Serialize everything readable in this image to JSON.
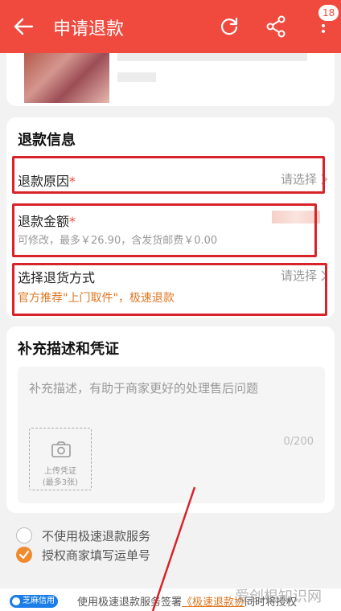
{
  "header": {
    "title": "申请退款",
    "badge_count": "18",
    "bg_color": "#f04a3f",
    "icons": [
      "back-arrow-icon",
      "refresh-icon",
      "share-icon",
      "more-vertical-icon"
    ]
  },
  "refund_info": {
    "section_title": "退款信息",
    "reason": {
      "label": "退款原因",
      "required_mark": "*",
      "value": "请选择"
    },
    "amount": {
      "label": "退款金额",
      "required_mark": "*",
      "hint": "可修改，最多￥26.90，含发货邮费￥0.00"
    },
    "return_method": {
      "label": "选择退货方式",
      "value": "请选择",
      "promo": "官方推荐\"上门取件\"，极速退款"
    }
  },
  "description": {
    "section_title": "补充描述和凭证",
    "placeholder": "补充描述，有助于商家更好的处理售后问题",
    "counter": "0/200",
    "upload_line1": "上传凭证",
    "upload_line2": "(最多3张)"
  },
  "options": [
    {
      "label": "不使用极速退款服务",
      "checked": false
    },
    {
      "label": "授权商家填写运单号",
      "checked": true
    }
  ],
  "footer": {
    "badge": "芝麻信用",
    "text_prefix": "使用极速退款服务",
    "text_sign": "签署",
    "link": "《极速退款协",
    "text_suffix": "同时将授权"
  },
  "watermark": "爱创根知识网",
  "colors": {
    "accent": "#f04a3f",
    "highlight_border": "#d8232a",
    "promo": "#e07520",
    "radio_on": "#f08a2c"
  }
}
